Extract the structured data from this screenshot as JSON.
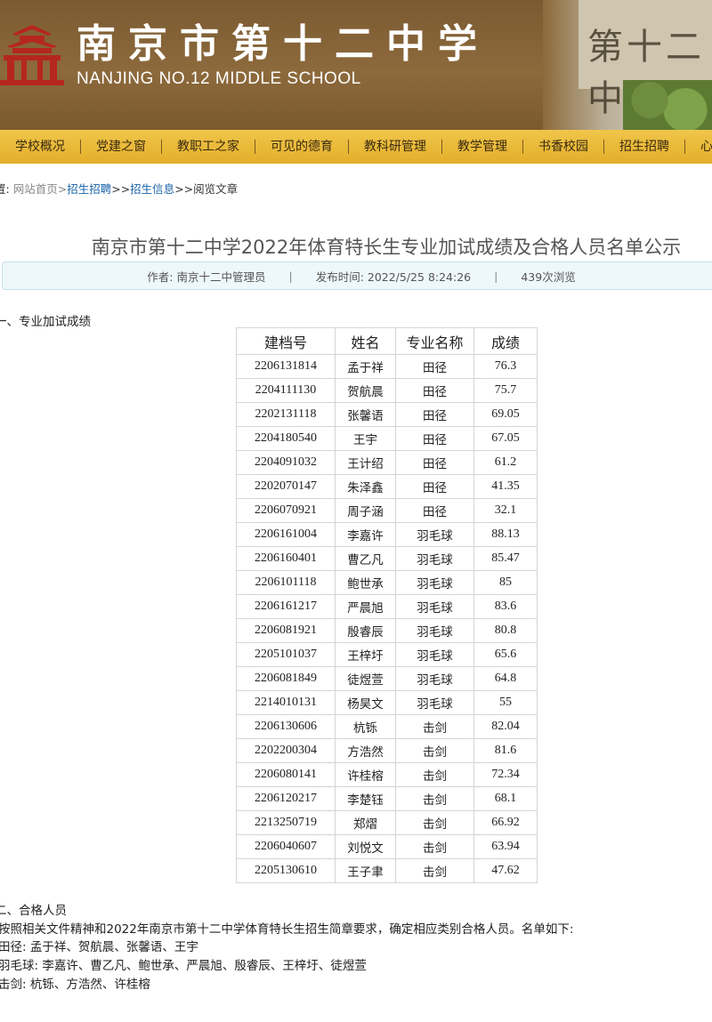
{
  "header": {
    "school_name_cn": "南京市第十二中学",
    "school_name_en": "NANJING NO.12 MIDDLE SCHOOL",
    "photo_wall_text": "第十二中"
  },
  "nav": {
    "items": [
      "学校概况",
      "党建之窗",
      "教职工之家",
      "可见的德育",
      "教科研管理",
      "教学管理",
      "书香校园",
      "招生招聘",
      "心理"
    ]
  },
  "breadcrumb": {
    "prefix": "置:",
    "home": "网站首页",
    "sep1": ">",
    "level1": "招生招聘",
    "sep2": ">>",
    "level2": "招生信息",
    "sep3": ">>",
    "current": "阅览文章"
  },
  "article": {
    "title": "南京市第十二中学2022年体育特长生专业加试成绩及合格人员名单公示",
    "author": "作者: 南京十二中管理员",
    "published": "发布时间: 2022/5/25 8:24:26",
    "views": "439次浏览",
    "separator": "|"
  },
  "section1": {
    "heading": "一、专业加试成绩",
    "table": {
      "headers": [
        "建档号",
        "姓名",
        "专业名称",
        "成绩"
      ],
      "rows": [
        [
          "2206131814",
          "孟于祥",
          "田径",
          "76.3"
        ],
        [
          "2204111130",
          "贺航晨",
          "田径",
          "75.7"
        ],
        [
          "2202131118",
          "张馨语",
          "田径",
          "69.05"
        ],
        [
          "2204180540",
          "王宇",
          "田径",
          "67.05"
        ],
        [
          "2204091032",
          "王计绍",
          "田径",
          "61.2"
        ],
        [
          "2202070147",
          "朱泽鑫",
          "田径",
          "41.35"
        ],
        [
          "2206070921",
          "周子涵",
          "田径",
          "32.1"
        ],
        [
          "2206161004",
          "李嘉许",
          "羽毛球",
          "88.13"
        ],
        [
          "2206160401",
          "曹乙凡",
          "羽毛球",
          "85.47"
        ],
        [
          "2206101118",
          "鲍世承",
          "羽毛球",
          "85"
        ],
        [
          "2206161217",
          "严晨旭",
          "羽毛球",
          "83.6"
        ],
        [
          "2206081921",
          "殷睿辰",
          "羽毛球",
          "80.8"
        ],
        [
          "2205101037",
          "王梓圩",
          "羽毛球",
          "65.6"
        ],
        [
          "2206081849",
          "徒煜萱",
          "羽毛球",
          "64.8"
        ],
        [
          "2214010131",
          "杨昊文",
          "羽毛球",
          "55"
        ],
        [
          "2206130606",
          "杭铄",
          "击剑",
          "82.04"
        ],
        [
          "2202200304",
          "方浩然",
          "击剑",
          "81.6"
        ],
        [
          "2206080141",
          "许桂榕",
          "击剑",
          "72.34"
        ],
        [
          "2206120217",
          "李楚钰",
          "击剑",
          "68.1"
        ],
        [
          "2213250719",
          "郑熠",
          "击剑",
          "66.92"
        ],
        [
          "2206040607",
          "刘悦文",
          "击剑",
          "63.94"
        ],
        [
          "2205130610",
          "王子聿",
          "击剑",
          "47.62"
        ]
      ]
    }
  },
  "section2": {
    "heading": "二、合格人员",
    "intro": "按照相关文件精神和2022年南京市第十二中学体育特长生招生简章要求，确定相应类别合格人员。名单如下:",
    "track": "田径: 孟于祥、贺航晨、张馨语、王宇",
    "badminton": "羽毛球: 李嘉许、曹乙凡、鲍世承、严晨旭、殷睿辰、王梓圩、徒煜萱",
    "fencing": "击剑: 杭铄、方浩然、许桂榕"
  },
  "colors": {
    "banner": "#8d6a3c",
    "nav": "#e9b83a",
    "link": "#1a63a8",
    "meta_bar_bg": "#eef7fb"
  }
}
